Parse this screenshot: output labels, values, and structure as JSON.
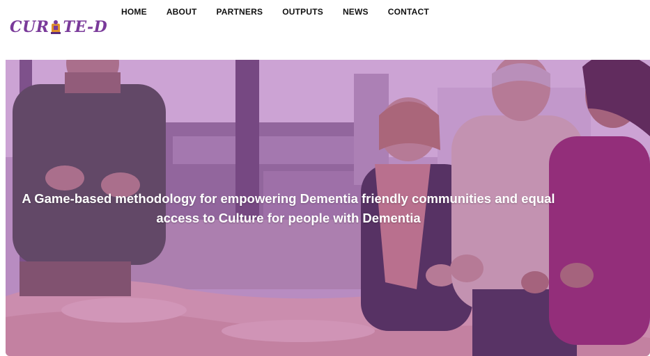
{
  "brand": {
    "logo_text_left": "CUR",
    "logo_text_right": "TE-D",
    "logo_color": "#7a3a9a"
  },
  "nav": {
    "items": [
      {
        "label": "HOME"
      },
      {
        "label": "ABOUT"
      },
      {
        "label": "PARTNERS"
      },
      {
        "label": "OUTPUTS"
      },
      {
        "label": "NEWS"
      },
      {
        "label": "CONTACT"
      }
    ]
  },
  "hero": {
    "headline_line1": "A Game-based methodology for empowering Dementia friendly communities and equal",
    "headline_line2": "access to Culture for people with Dementia",
    "overlay_color": "#a046af"
  }
}
